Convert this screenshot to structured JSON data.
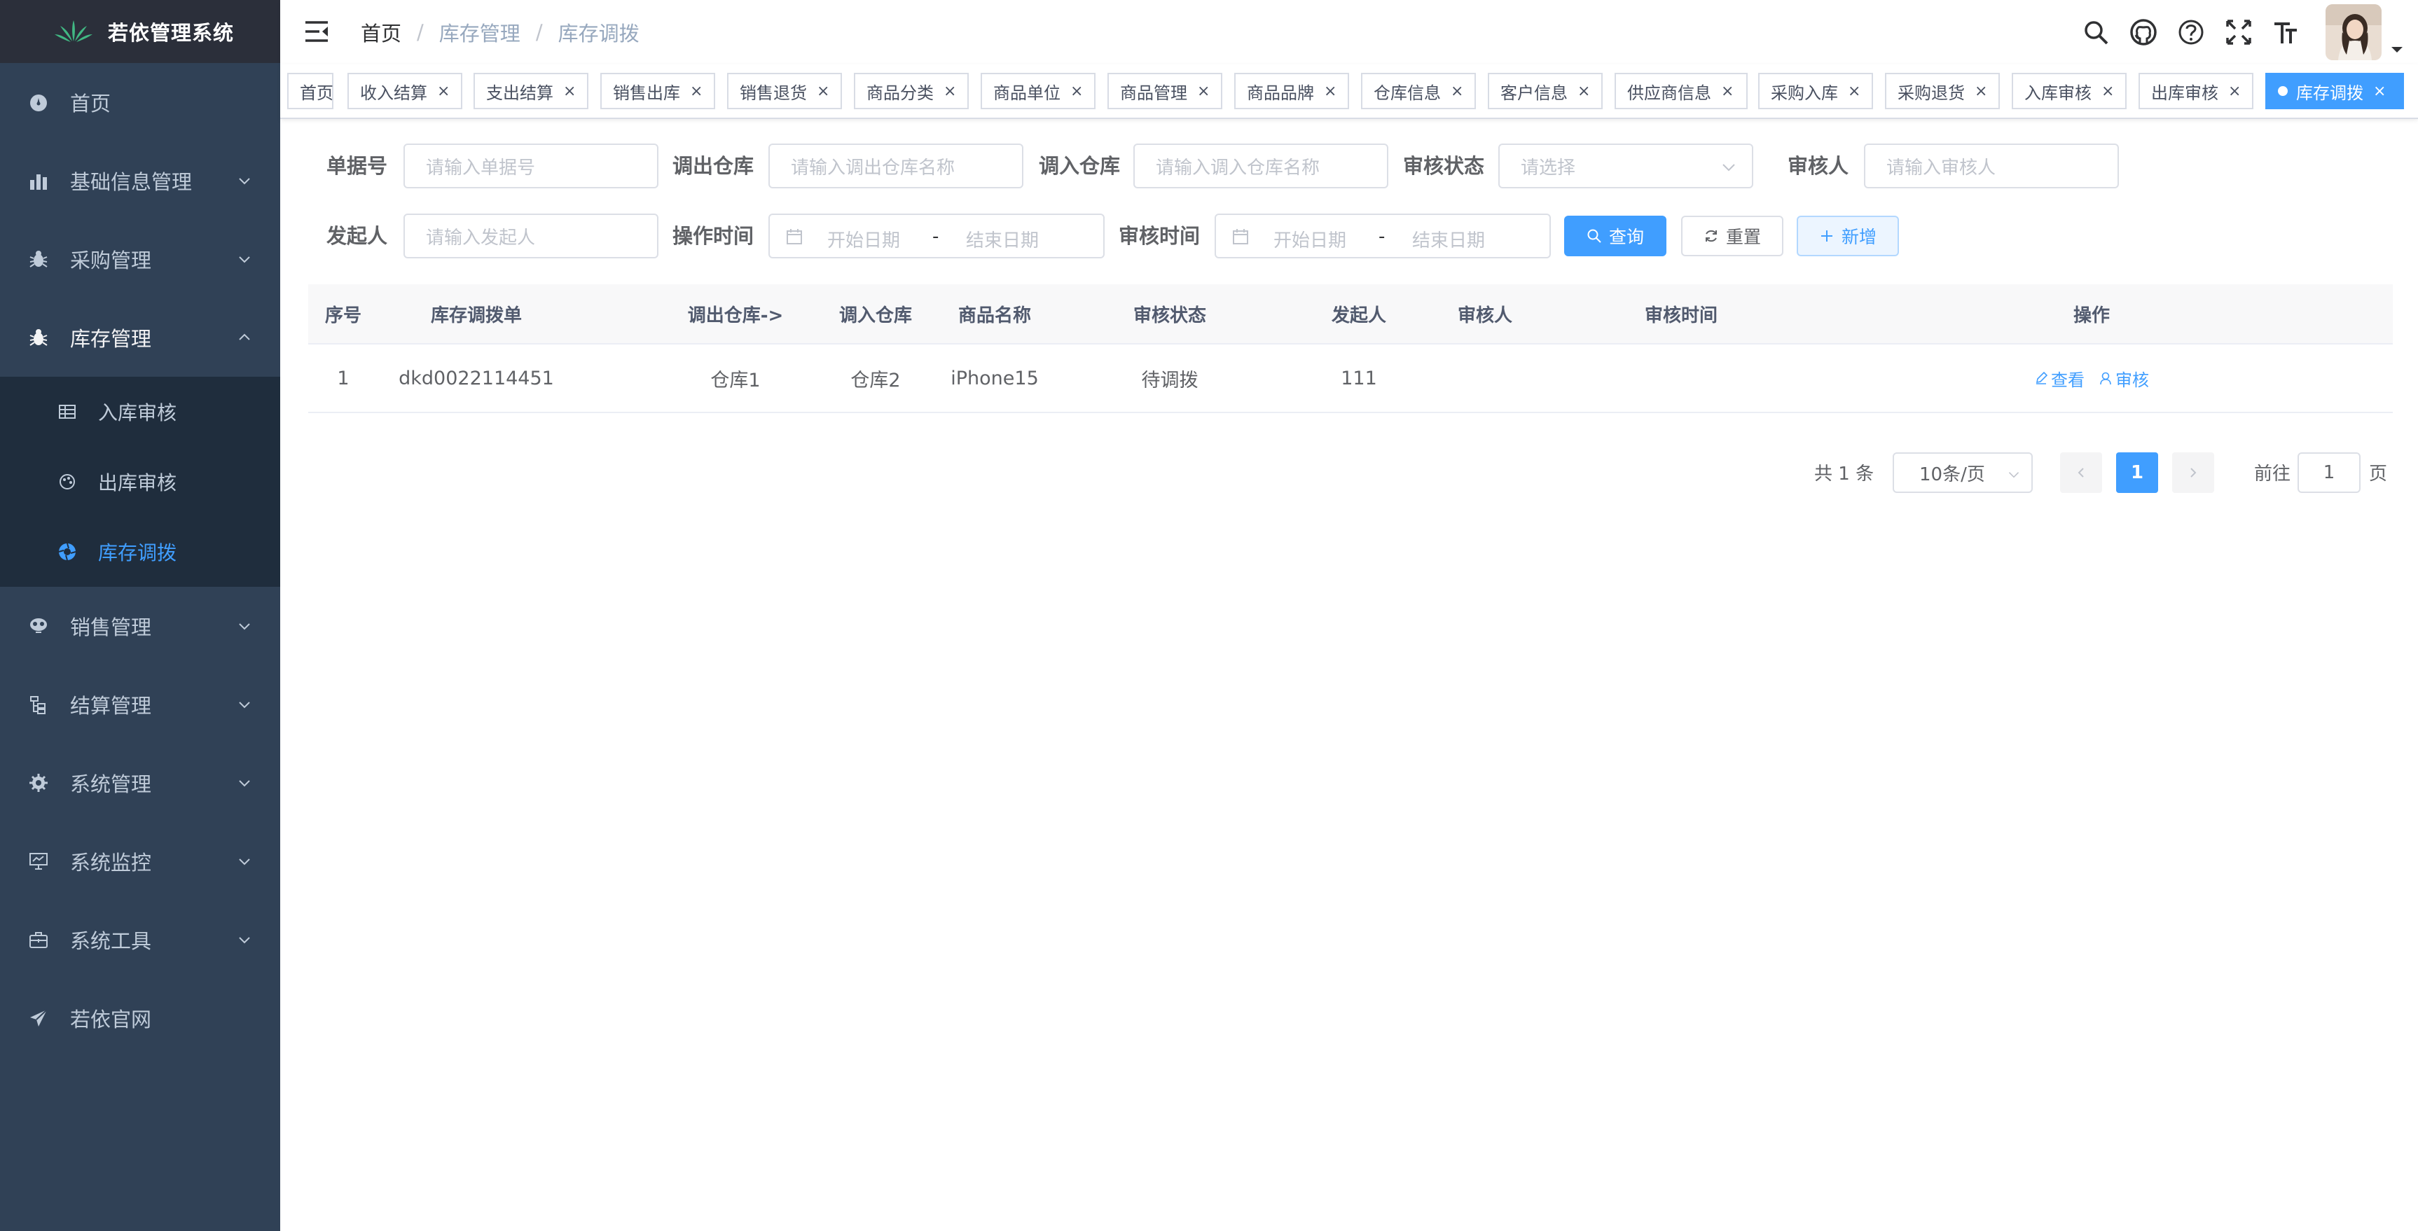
{
  "app": {
    "title": "若依管理系统",
    "colors": {
      "sidebar_bg": "#304156",
      "submenu_bg": "#1f2d3d",
      "accent": "#409eff",
      "active_tag": "#42b983"
    }
  },
  "sidebar": {
    "items": [
      {
        "label": "首页",
        "icon": "dashboard-icon"
      },
      {
        "label": "基础信息管理",
        "icon": "chart-icon"
      },
      {
        "label": "采购管理",
        "icon": "bug-icon"
      },
      {
        "label": "库存管理",
        "icon": "bug-icon",
        "expanded": true,
        "children": [
          {
            "label": "入库审核",
            "icon": "table-icon"
          },
          {
            "label": "出库审核",
            "icon": "color-icon"
          },
          {
            "label": "库存调拨",
            "icon": "chromatic-icon",
            "active": true
          }
        ]
      },
      {
        "label": "销售管理",
        "icon": "monitor-icon"
      },
      {
        "label": "结算管理",
        "icon": "tree-icon"
      },
      {
        "label": "系统管理",
        "icon": "gear-icon"
      },
      {
        "label": "系统监控",
        "icon": "monitor-icon"
      },
      {
        "label": "系统工具",
        "icon": "tool-icon"
      },
      {
        "label": "若依官网",
        "icon": "paper-plane-icon"
      }
    ]
  },
  "navbar": {
    "breadcrumb": [
      "首页",
      "库存管理",
      "库存调拨"
    ],
    "icons": [
      "search-icon",
      "github-icon",
      "question-icon",
      "fullscreen-icon",
      "font-size-icon"
    ]
  },
  "tags": [
    {
      "label": "首页",
      "closable": false
    },
    {
      "label": "收入结算"
    },
    {
      "label": "支出结算"
    },
    {
      "label": "销售出库"
    },
    {
      "label": "销售退货"
    },
    {
      "label": "商品分类"
    },
    {
      "label": "商品单位"
    },
    {
      "label": "商品管理"
    },
    {
      "label": "商品品牌"
    },
    {
      "label": "仓库信息"
    },
    {
      "label": "客户信息"
    },
    {
      "label": "供应商信息"
    },
    {
      "label": "采购入库"
    },
    {
      "label": "采购退货"
    },
    {
      "label": "入库审核"
    },
    {
      "label": "出库审核"
    },
    {
      "label": "库存调拨",
      "active": true
    }
  ],
  "form": {
    "order_no": {
      "label": "单据号",
      "placeholder": "请输入单据号"
    },
    "out_wh": {
      "label": "调出仓库",
      "placeholder": "请输入调出仓库名称"
    },
    "in_wh": {
      "label": "调入仓库",
      "placeholder": "请输入调入仓库名称"
    },
    "status": {
      "label": "审核状态",
      "placeholder": "请选择"
    },
    "auditor": {
      "label": "审核人",
      "placeholder": "请输入审核人"
    },
    "initiator": {
      "label": "发起人",
      "placeholder": "请输入发起人"
    },
    "op_time": {
      "label": "操作时间",
      "start": "开始日期",
      "dash": "-",
      "end": "结束日期"
    },
    "audit_time": {
      "label": "审核时间",
      "start": "开始日期",
      "dash": "-",
      "end": "结束日期"
    },
    "buttons": {
      "search": "查询",
      "reset": "重置",
      "add": "新增"
    }
  },
  "table": {
    "columns": [
      "序号",
      "库存调拨单",
      "调出仓库->",
      "调入仓库",
      "商品名称",
      "审核状态",
      "发起人",
      "审核人",
      "审核时间",
      "操作"
    ],
    "rows": [
      {
        "index": "1",
        "order": "dkd0022114451",
        "out_wh": "仓库1",
        "in_wh": "仓库2",
        "product": "iPhone15",
        "status": "待调拨",
        "initiator": "111",
        "auditor": "",
        "audit_time": ""
      }
    ],
    "actions": {
      "view": "查看",
      "audit": "审核"
    }
  },
  "pagination": {
    "total_text": "共 1 条",
    "page_size": "10条/页",
    "current": "1",
    "goto_prefix": "前往",
    "goto_value": "1",
    "goto_suffix": "页"
  }
}
